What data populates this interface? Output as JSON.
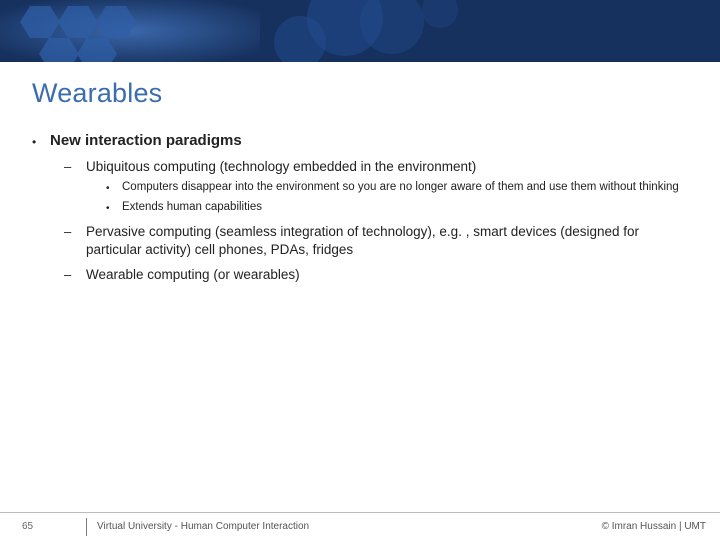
{
  "title": "Wearables",
  "bullets": {
    "lvl1": {
      "label": "New interaction paradigms"
    },
    "children": [
      {
        "label": "Ubiquitous computing (technology embedded in the environment)",
        "sub": [
          "Computers disappear into the environment so you are no longer aware of them and use them without thinking",
          "Extends human capabilities"
        ]
      },
      {
        "label": "Pervasive computing (seamless integration of technology), e.g. , smart devices (designed for particular activity) cell phones, PDAs, fridges",
        "sub": []
      },
      {
        "label": "Wearable computing (or wearables)",
        "sub": []
      }
    ]
  },
  "footer": {
    "page": "65",
    "course": "Virtual University - Human Computer Interaction",
    "credit": "© Imran Hussain | UMT"
  },
  "glyphs": {
    "dot": "•",
    "dash": "–"
  }
}
